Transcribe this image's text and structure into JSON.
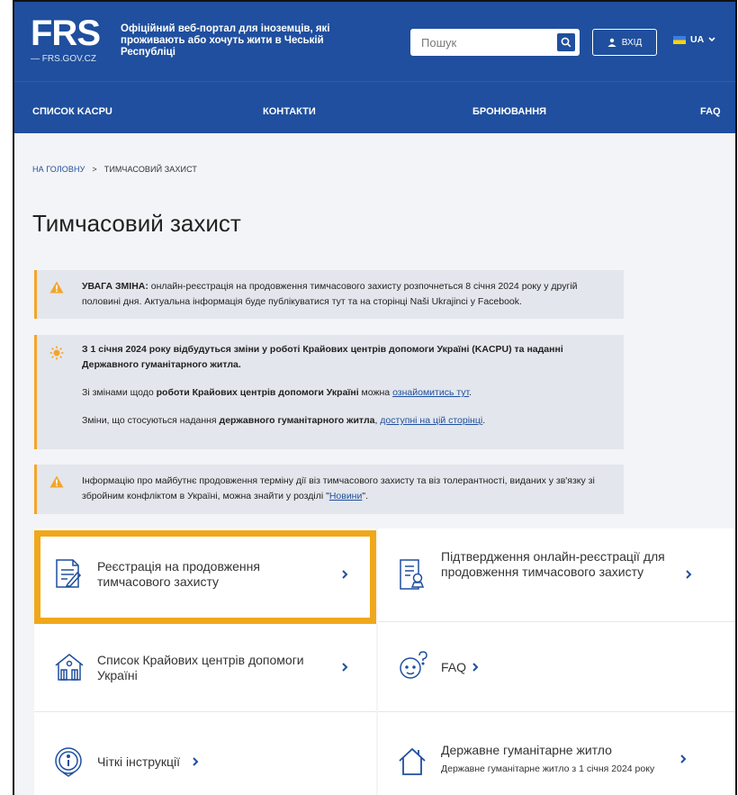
{
  "header": {
    "logo_text": "FRS",
    "logo_sub": "— FRS.GOV.CZ",
    "tagline": "Офіційний веб-портал для іноземців, які проживають або хочуть жити в Чеській Республіці",
    "search_placeholder": "Пошук",
    "login_label": "ВХІД",
    "lang_label": "UA"
  },
  "nav": {
    "items": [
      "СПИСОК KACPU",
      "КОНТАКТИ",
      "БРОНЮВАННЯ",
      "FAQ"
    ]
  },
  "breadcrumb": {
    "home": "НА ГОЛОВНУ",
    "separator": ">",
    "current": "ТИМЧАСОВИЙ ЗАХИСТ"
  },
  "page_title": "Тимчасовий захист",
  "notices": {
    "n1": {
      "strong": "УВАГА ЗМІНА:",
      "text": " онлайн-реєстрація на продовження тимчасового захисту розпочнеться 8 січня 2024 року у другій половині дня. Актуальна інформація буде публікуватися тут та на сторінці Naši Ukrajinci у Facebook."
    },
    "n2": {
      "heading": "З 1 січня 2024 року відбудуться зміни у роботі Крайових центрів допомоги Україні (KACPU) та наданні Державного гуманітарного житла.",
      "line1_pre": "Зі змінами щодо ",
      "line1_strong": "роботи Крайових центрів допомоги Україні",
      "line1_mid": " можна ",
      "line1_link": "ознайомитись тут",
      "line1_end": ".",
      "line2_pre": "Зміни, що стосуються надання ",
      "line2_strong": "державного гуманітарного житла",
      "line2_mid": ", ",
      "line2_link": "доступні на цій сторінці",
      "line2_end": "."
    },
    "n3": {
      "text_pre": "Інформацію про майбутнє продовження терміну дії віз тимчасового захисту та віз толерантності, виданих у зв'язку зі збройним конфліктом в Україні, можна знайти у розділі \"",
      "link": "Новини",
      "text_end": "\"."
    }
  },
  "cards": {
    "c1": "Реєстрація на продовження тимчасового захисту",
    "c2": "Підтвердження онлайн-реєстрації для продовження тимчасового захисту",
    "c3": "Список Крайових центрів допомоги Україні",
    "c4": "FAQ",
    "c5": "Чіткі інструкції",
    "c6": "Державне гуманітарне житло",
    "c6_sub": "Державне гуманітарне житло з 1 січня 2024 року"
  },
  "colors": {
    "brand_blue": "#1f4f9e",
    "warning_orange": "#f3a52a",
    "highlight_gold": "#f0a81a"
  },
  "icons": [
    "search-icon",
    "user-icon",
    "chevron-down-icon",
    "warning-icon",
    "sun-icon",
    "form-icon",
    "certificate-icon",
    "house-icon",
    "help-face-icon",
    "info-icon",
    "home-outline-icon",
    "chevron-right-icon"
  ]
}
